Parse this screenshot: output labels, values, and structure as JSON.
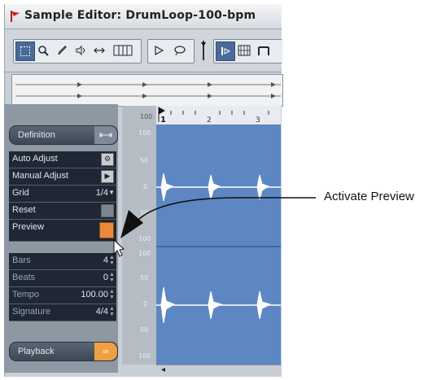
{
  "window": {
    "title": "Sample Editor: DrumLoop-100-bpm"
  },
  "toolbar": {
    "tools": [
      "range-select",
      "zoom",
      "pencil",
      "play-speaker",
      "scrub",
      "snap-grid",
      "play",
      "loop",
      "audition",
      "hitpoint",
      "region"
    ]
  },
  "ruler": {
    "marks": [
      "1",
      "2",
      "3"
    ]
  },
  "scale": {
    "top_label": "100",
    "labels": [
      "100",
      "50",
      "0",
      "50",
      "100",
      "100",
      "50",
      "0",
      "50",
      "100"
    ]
  },
  "panel": {
    "definition_label": "Definition",
    "auto_adjust_label": "Auto Adjust",
    "manual_adjust_label": "Manual Adjust",
    "grid_label": "Grid",
    "grid_value": "1/4",
    "reset_label": "Reset",
    "preview_label": "Preview",
    "bars_label": "Bars",
    "bars_value": "4",
    "beats_label": "Beats",
    "beats_value": "0",
    "tempo_label": "Tempo",
    "tempo_value": "100.00",
    "signature_label": "Signature",
    "signature_value": "4/4",
    "playback_label": "Playback"
  },
  "annotation": {
    "text": "Activate Preview"
  },
  "colors": {
    "waveform_bg": "#5d87c2",
    "panel_row": "#1e2733",
    "preview_button": "#e88a3a",
    "playback_button": "#f0a040"
  }
}
